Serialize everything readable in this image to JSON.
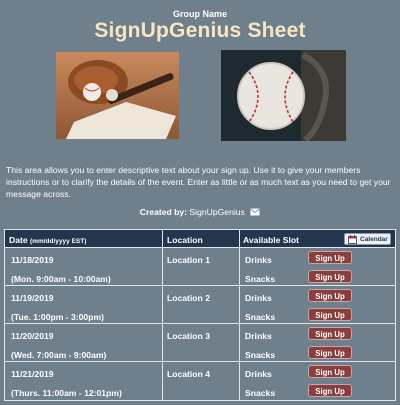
{
  "header": {
    "group_name": "Group Name",
    "title": "SignUpGenius Sheet"
  },
  "description": "This area allows you to enter descriptive text about your sign up. Use it to give your members instructions or to clarify the details of the event. Enter as little or as much text as you need to get your message across.",
  "created_by": {
    "label": "Created by:",
    "name": "SignUpGenius"
  },
  "table": {
    "headers": {
      "date": "Date",
      "date_format": "(mm/dd/yyyy EST)",
      "location": "Location",
      "slot": "Available Slot"
    },
    "calendar_label": "Calendar",
    "signup_label": "Sign Up",
    "rows": [
      {
        "date": "11/18/2019",
        "time": "(Mon. 9:00am - 10:00am)",
        "location": "Location 1",
        "slot1": "Drinks",
        "slot2": "Snacks"
      },
      {
        "date": "11/19/2019",
        "time": "(Tue. 1:00pm - 3:00pm)",
        "location": "Location 2",
        "slot1": "Drinks",
        "slot2": "Snacks"
      },
      {
        "date": "11/20/2019",
        "time": "(Wed. 7:00am - 9:00am)",
        "location": "Location 3",
        "slot1": "Drinks",
        "slot2": "Snacks"
      },
      {
        "date": "11/21/2019",
        "time": "(Thurs. 11:00am - 12:01pm)",
        "location": "Location 4",
        "slot1": "Drinks",
        "slot2": "Snacks"
      }
    ]
  },
  "colors": {
    "background": "#6f7f8c",
    "title": "#f6e7c2",
    "table_header": "#24364d",
    "signup_button": "#8b3e3e"
  }
}
